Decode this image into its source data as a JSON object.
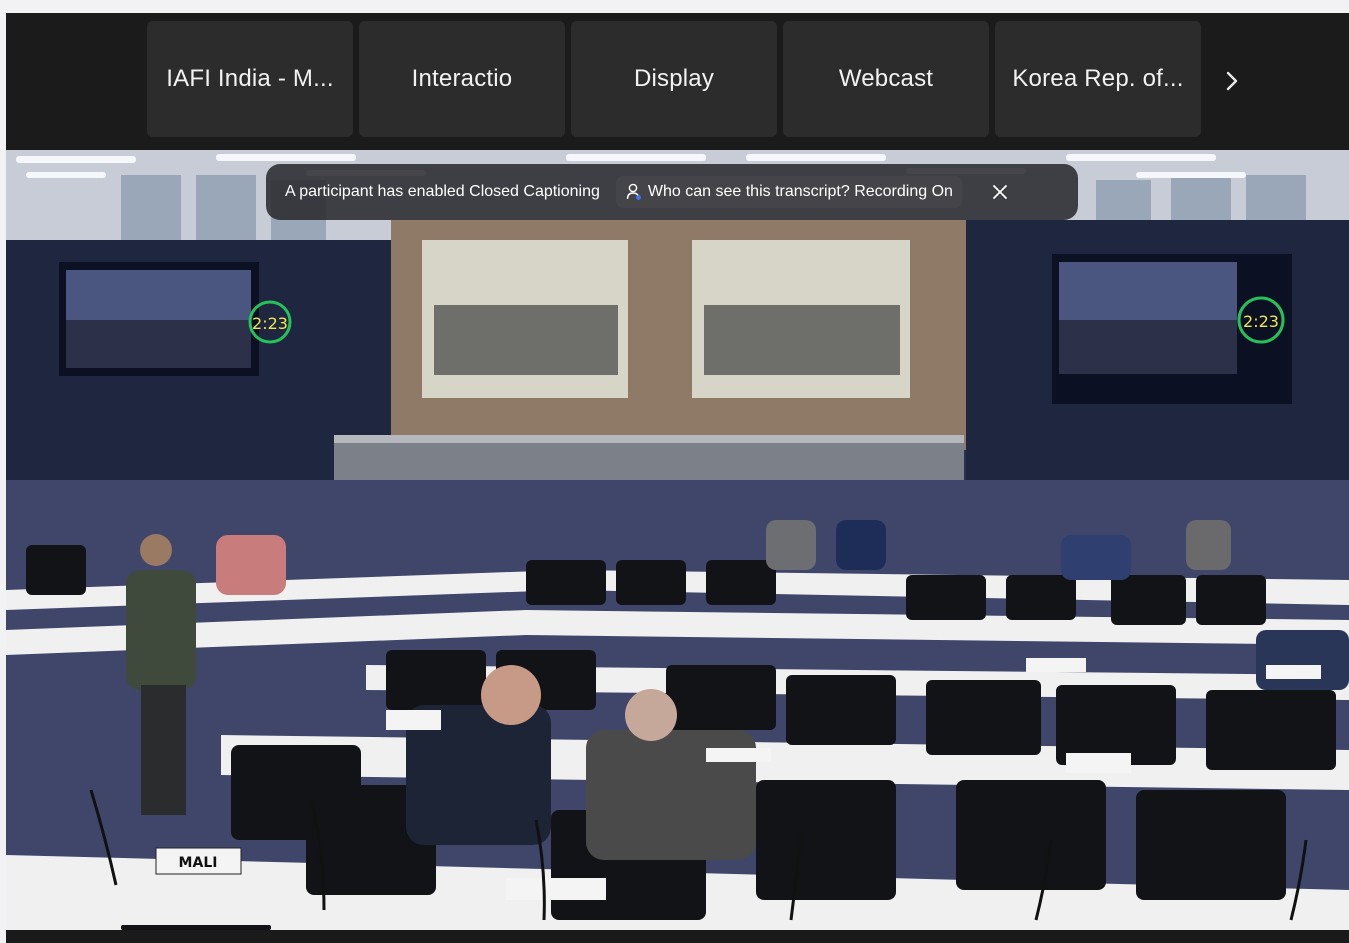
{
  "gallery": {
    "tiles": [
      {
        "label": "IAFI India - M..."
      },
      {
        "label": "Interactio"
      },
      {
        "label": "Display"
      },
      {
        "label": "Webcast"
      },
      {
        "label": "Korea Rep. of..."
      }
    ],
    "next_icon": "chevron-right-icon"
  },
  "caption_banner": {
    "message": "A participant has enabled Closed Captioning",
    "transcript_link": "Who can see this transcript? Recording On",
    "person_icon": "person-icon",
    "close_icon": "close-icon"
  },
  "video": {
    "screen_timer_left": "2:23",
    "screen_timer_right": "2:23",
    "name_plates": {
      "mali": "MALI"
    }
  },
  "colors": {
    "tile_bg": "#2c2c2c",
    "strip_bg": "#1b1b1b",
    "banner_bg": "#28282c"
  }
}
